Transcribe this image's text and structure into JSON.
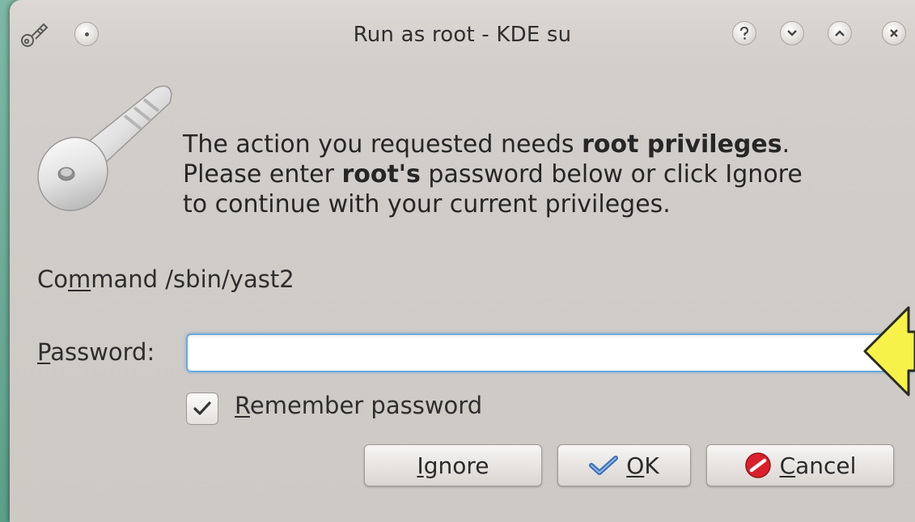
{
  "window": {
    "title": "Run as root - KDE su"
  },
  "message": {
    "line1_pre": "The action you requested needs ",
    "line1_bold": "root privileges",
    "line1_post": ".",
    "line2_pre": "Please enter ",
    "line2_bold": "root's",
    "line2_post": " password below or click Ignore",
    "line3": "to continue with your current privileges."
  },
  "command": {
    "label_pre": "Co",
    "label_mnemonic": "m",
    "label_post": "mand",
    "value": "/sbin/yast2"
  },
  "password": {
    "label_mnemonic": "P",
    "label_post": "assword:",
    "value": ""
  },
  "remember": {
    "label_mnemonic": "R",
    "label_post": "emember password",
    "checked": true
  },
  "buttons": {
    "ignore_mnemonic": "I",
    "ignore_post": "gnore",
    "ok_mnemonic": "O",
    "ok_post": "K",
    "cancel_mnemonic": "C",
    "cancel_post": "ancel"
  },
  "colors": {
    "focus_border": "#6aa9da",
    "ok_check": "#3a6fb5",
    "cancel_icon": "#d9202c",
    "arrow_fill": "#f6f24a"
  }
}
